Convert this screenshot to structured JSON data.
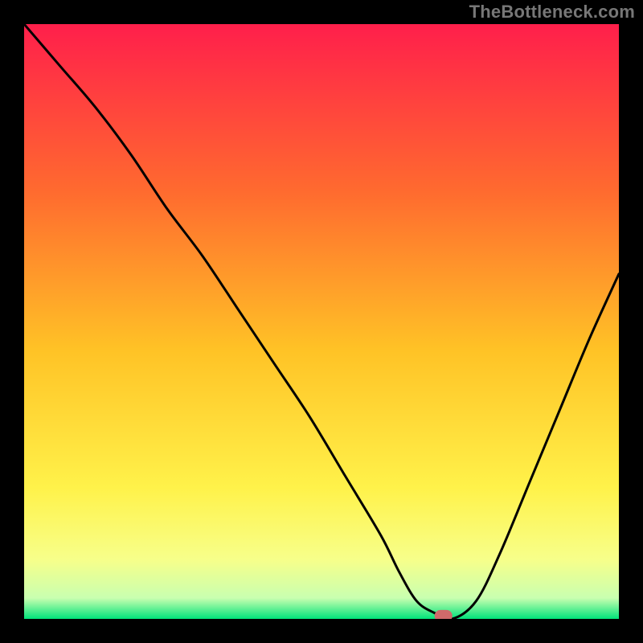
{
  "watermark": "TheBottleneck.com",
  "chart_data": {
    "type": "line",
    "title": "",
    "xlabel": "",
    "ylabel": "",
    "xlim": [
      0,
      100
    ],
    "ylim": [
      0,
      100
    ],
    "grid": false,
    "legend": false,
    "background": {
      "type": "vertical-gradient",
      "stops": [
        {
          "pos": 0.0,
          "color": "#ff1f4b"
        },
        {
          "pos": 0.28,
          "color": "#ff6a2f"
        },
        {
          "pos": 0.55,
          "color": "#ffc326"
        },
        {
          "pos": 0.78,
          "color": "#fff24a"
        },
        {
          "pos": 0.9,
          "color": "#f7ff8a"
        },
        {
          "pos": 0.965,
          "color": "#c9ffb0"
        },
        {
          "pos": 1.0,
          "color": "#00e37a"
        }
      ]
    },
    "series": [
      {
        "name": "bottleneck-curve",
        "x": [
          0,
          6,
          12,
          18,
          24,
          30,
          36,
          42,
          48,
          54,
          60,
          63,
          66,
          69,
          72,
          76,
          80,
          85,
          90,
          95,
          100
        ],
        "y": [
          100,
          93,
          86,
          78,
          69,
          61,
          52,
          43,
          34,
          24,
          14,
          8,
          3,
          1,
          0,
          3,
          11,
          23,
          35,
          47,
          58
        ]
      }
    ],
    "marker": {
      "name": "highlight-marker",
      "x": 70.5,
      "y": 0.5,
      "width": 3,
      "height": 2,
      "rx": 1,
      "color": "#cf6a6a"
    }
  }
}
